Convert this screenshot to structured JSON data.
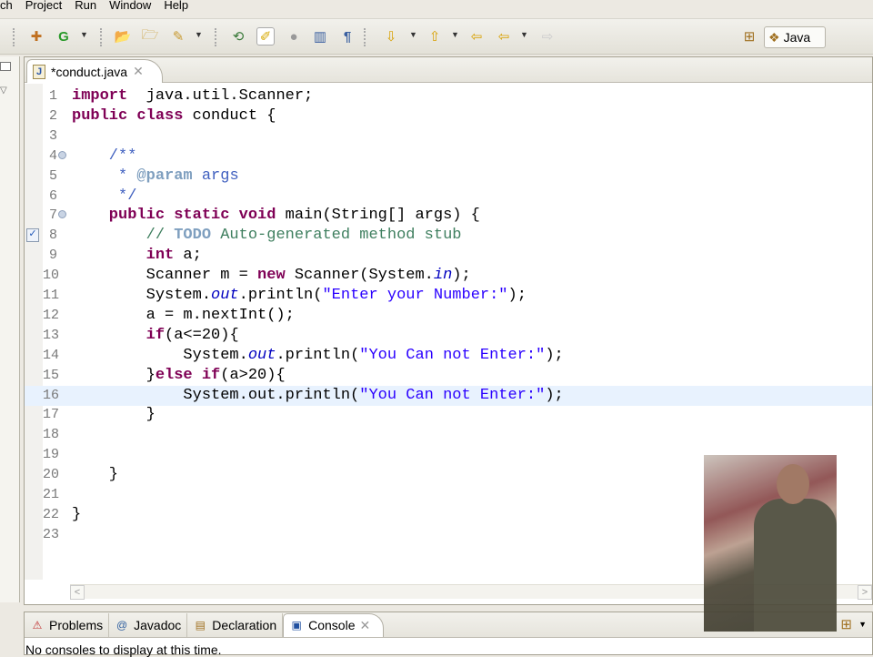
{
  "menu": [
    "ch",
    "Project",
    "Run",
    "Window",
    "Help"
  ],
  "perspective": {
    "label": "Java"
  },
  "editor": {
    "tab_title": "*conduct.java",
    "lines": [
      {
        "n": "1",
        "t": [
          [
            "kw",
            "import"
          ],
          [
            "",
            "  java.util.Scanner;"
          ]
        ]
      },
      {
        "n": "2",
        "t": [
          [
            "kw",
            "public class"
          ],
          [
            "",
            " conduct {"
          ]
        ]
      },
      {
        "n": "3",
        "t": []
      },
      {
        "n": "4",
        "fold": true,
        "t": [
          [
            "doc",
            "    /**"
          ]
        ]
      },
      {
        "n": "5",
        "t": [
          [
            "doc",
            "     * "
          ],
          [
            "tag",
            "@param"
          ],
          [
            "doc",
            " args"
          ]
        ]
      },
      {
        "n": "6",
        "t": [
          [
            "doc",
            "     */"
          ]
        ]
      },
      {
        "n": "7",
        "fold": true,
        "t": [
          [
            "kw",
            "    public static void"
          ],
          [
            "",
            " main(String[] args) {"
          ]
        ]
      },
      {
        "n": "8",
        "task": true,
        "t": [
          [
            "com",
            "        // "
          ],
          [
            "tag",
            "TODO"
          ],
          [
            "com",
            " Auto-generated method stub"
          ]
        ]
      },
      {
        "n": "9",
        "t": [
          [
            "kw",
            "        int"
          ],
          [
            "",
            " a;"
          ]
        ]
      },
      {
        "n": "10",
        "t": [
          [
            "",
            "        Scanner m = "
          ],
          [
            "kw",
            "new"
          ],
          [
            "",
            " Scanner(System."
          ],
          [
            "fld",
            "in"
          ],
          [
            "",
            ");"
          ]
        ]
      },
      {
        "n": "11",
        "t": [
          [
            "",
            "        System."
          ],
          [
            "fld",
            "out"
          ],
          [
            "",
            ".println("
          ],
          [
            "str",
            "\"Enter your Number:\""
          ],
          [
            "",
            ");"
          ]
        ]
      },
      {
        "n": "12",
        "t": [
          [
            "",
            "        a = m.nextInt();"
          ]
        ]
      },
      {
        "n": "13",
        "t": [
          [
            "kw",
            "        if"
          ],
          [
            "",
            "(a<=20){"
          ]
        ]
      },
      {
        "n": "14",
        "t": [
          [
            "",
            "            System."
          ],
          [
            "fld",
            "out"
          ],
          [
            "",
            ".println("
          ],
          [
            "str",
            "\"You Can not Enter:\""
          ],
          [
            "",
            ");"
          ]
        ]
      },
      {
        "n": "15",
        "t": [
          [
            "",
            "        }"
          ],
          [
            "kw",
            "else if"
          ],
          [
            "",
            "(a>20){"
          ]
        ]
      },
      {
        "n": "16",
        "cur": true,
        "t": [
          [
            "",
            "            System.out.println("
          ],
          [
            "str",
            "\"You Can not Enter:\""
          ],
          [
            "",
            ");"
          ]
        ]
      },
      {
        "n": "17",
        "t": [
          [
            "",
            "        }"
          ]
        ]
      },
      {
        "n": "18",
        "t": []
      },
      {
        "n": "19",
        "t": []
      },
      {
        "n": "20",
        "t": [
          [
            "",
            "    }"
          ]
        ]
      },
      {
        "n": "21",
        "t": []
      },
      {
        "n": "22",
        "t": [
          [
            "",
            "}"
          ]
        ]
      },
      {
        "n": "23",
        "t": []
      }
    ]
  },
  "bottom": {
    "tabs": [
      {
        "label": "Problems",
        "icon": "problems-icon",
        "glyph": "⚠"
      },
      {
        "label": "Javadoc",
        "icon": "at-icon",
        "glyph": "@"
      },
      {
        "label": "Declaration",
        "icon": "declaration-icon",
        "glyph": "▤"
      },
      {
        "label": "Console",
        "icon": "console-icon",
        "glyph": "▣",
        "active": true
      }
    ],
    "status": "No consoles to display at this time."
  }
}
